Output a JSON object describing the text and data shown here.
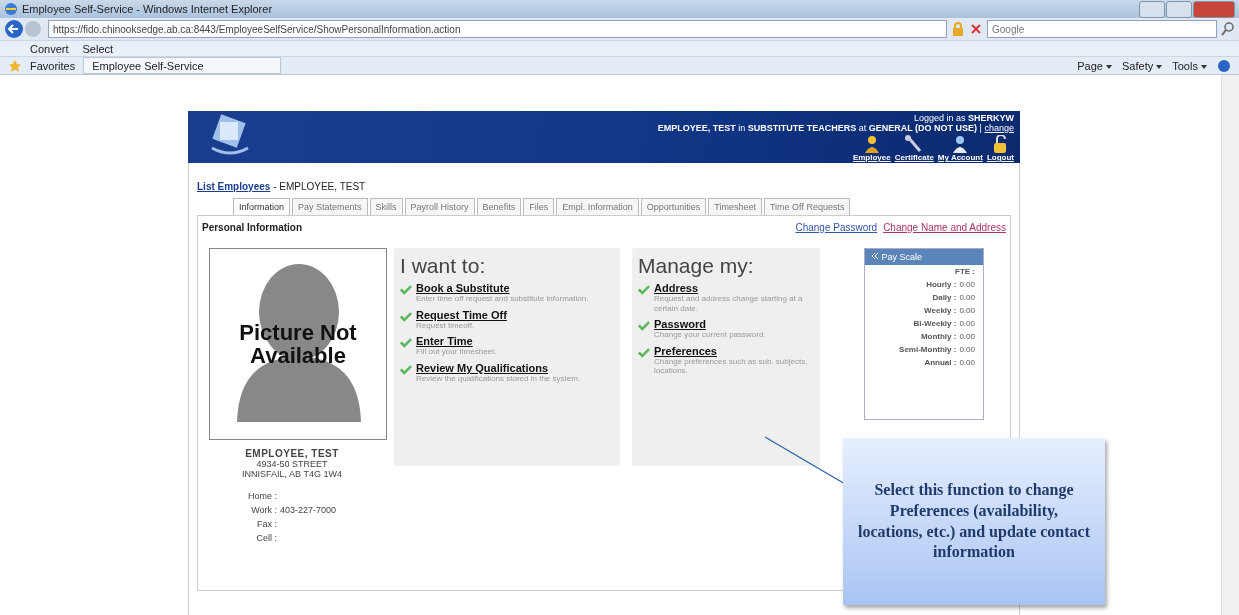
{
  "browser": {
    "title": "Employee Self-Service - Windows Internet Explorer",
    "url": "https://fido.chinooksedge.ab.ca:8443/EmployeeSelfService/ShowPersonalInformation.action",
    "search_placeholder": "Google",
    "toolbar": [
      "Convert",
      "Select"
    ],
    "favorites_label": "Favorites",
    "tab_label": "Employee Self-Service",
    "commands": [
      "Page",
      "Safety",
      "Tools"
    ]
  },
  "header": {
    "logged_in": "Logged in as **SHERKYW**",
    "context": "**EMPLOYEE, TEST** in **SUBSTITUTE TEACHERS** at **GENERAL (DO NOT USE)** |",
    "change_link": "change",
    "actions": [
      {
        "kind": "employee",
        "label": "Employee"
      },
      {
        "kind": "certificate",
        "label": "Certificate"
      },
      {
        "kind": "account",
        "label": "My Account"
      },
      {
        "kind": "logout",
        "label": "Logout"
      }
    ]
  },
  "breadcrumb": {
    "link": "List Employees",
    "rest": "- EMPLOYEE, TEST"
  },
  "tabs": [
    {
      "label": "Information",
      "selected": true
    },
    {
      "label": "Pay Statements",
      "selected": false
    },
    {
      "label": "Skills",
      "selected": false
    },
    {
      "label": "Payroll History",
      "selected": false
    },
    {
      "label": "Benefits",
      "selected": false
    },
    {
      "label": "Files",
      "selected": false
    },
    {
      "label": "Empl. Information",
      "selected": false
    },
    {
      "label": "Opportunities",
      "selected": false
    },
    {
      "label": "Timesheet",
      "selected": false
    },
    {
      "label": "Time Off Requests",
      "selected": false
    }
  ],
  "panel": {
    "title": "Personal Information",
    "links": [
      {
        "kind": "password",
        "label": "Change Password"
      },
      {
        "kind": "name",
        "label": "Change Name and Address"
      }
    ]
  },
  "photo": {
    "text": "Picture Not Available"
  },
  "employee": {
    "name": "EMPLOYEE, TEST",
    "address": [
      "4934-50 STREET",
      "INNISFAIL, AB T4G 1W4"
    ],
    "contacts": [
      {
        "label": "Home :"
      },
      {
        "label": "Work :",
        "value": "403-227-7000"
      },
      {
        "label": "Fax :"
      },
      {
        "label": "Cell :"
      }
    ]
  },
  "sections": [
    {
      "heading": "I want to:",
      "items": [
        {
          "title": "Book a Substitute",
          "description": "Enter time off request and substitute information."
        },
        {
          "title": "Request Time Off",
          "description": "Request timeoff."
        },
        {
          "title": "Enter Time",
          "description": "Fill out your timesheet."
        },
        {
          "title": "Review My Qualifications",
          "description": "Review the qualifications stored in the system."
        }
      ]
    },
    {
      "heading": "Manage my:",
      "items": [
        {
          "title": "Address",
          "description": "Request and address change starting at a certain date."
        },
        {
          "title": "Password",
          "description": "Change your current password."
        },
        {
          "title": "Preferences",
          "description": "Change preferences such as sub. subjects, locations."
        }
      ]
    }
  ],
  "pay_scale": {
    "title": "Pay Scale",
    "rows": [
      {
        "label": "FTE :"
      },
      {
        "label": "Hourly :",
        "value": "0.00"
      },
      {
        "label": "Daily :",
        "value": "0.00"
      },
      {
        "label": "Weekly :",
        "value": "0.00"
      },
      {
        "label": "Bi-Weekly :",
        "value": "0.00"
      },
      {
        "label": "Monthly :",
        "value": "0.00"
      },
      {
        "label": "Semi-Monthly :",
        "value": "0.00"
      },
      {
        "label": "Annual :",
        "value": "0.00"
      }
    ]
  },
  "callout": {
    "text": "Select this function to change Preferences (availability, locations, etc.) and update contact information"
  }
}
